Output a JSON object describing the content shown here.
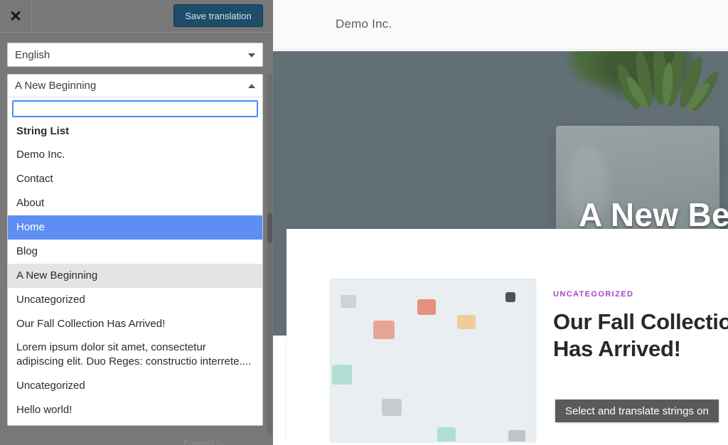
{
  "panel": {
    "close_label": "✕",
    "save_label": "Save translation",
    "language": {
      "selected": "English",
      "caret": "chevron-down-icon"
    },
    "string_combo": {
      "selected": "A New Beginning",
      "caret": "chevron-up-icon",
      "search_value": "",
      "search_placeholder": "",
      "options": [
        {
          "label": "String List",
          "type": "group",
          "state": "none"
        },
        {
          "label": "Demo Inc.",
          "type": "item",
          "state": "none"
        },
        {
          "label": "Contact",
          "type": "item",
          "state": "none"
        },
        {
          "label": "About",
          "type": "item",
          "state": "none"
        },
        {
          "label": "Home",
          "type": "item",
          "state": "selected"
        },
        {
          "label": "Blog",
          "type": "item",
          "state": "none"
        },
        {
          "label": "A New Beginning",
          "type": "item",
          "state": "hover"
        },
        {
          "label": "Uncategorized",
          "type": "item",
          "state": "none"
        },
        {
          "label": "Our Fall Collection Has Arrived!",
          "type": "item",
          "state": "none"
        },
        {
          "label": "Lorem ipsum dolor sit amet, consectetur adipiscing elit. Duo Reges: constructio interrete....",
          "type": "item",
          "state": "none"
        },
        {
          "label": "Uncategorized",
          "type": "item",
          "state": "none"
        },
        {
          "label": "Hello world!",
          "type": "item",
          "state": "none"
        }
      ]
    },
    "footnote": "Powered by "
  },
  "site": {
    "brand": "Demo Inc.",
    "hero_title": "A New Beginning",
    "post": {
      "category": "Uncategorized",
      "title": "Our Fall Collection Has Arrived!",
      "thumb_alt": "scattered-clothing-items-image"
    }
  },
  "tooltip": {
    "text": "Select and translate strings on "
  },
  "colors": {
    "panel_bg": "#787878",
    "save_button": "#1e4c6b",
    "option_selected": "#5f8ef2",
    "option_hover": "#e4e4e4",
    "focus_border": "#4a8cf7",
    "hero_bg": "#626f75",
    "category_accent": "#a347c9",
    "tooltip_bg": "#5a5a5a"
  }
}
